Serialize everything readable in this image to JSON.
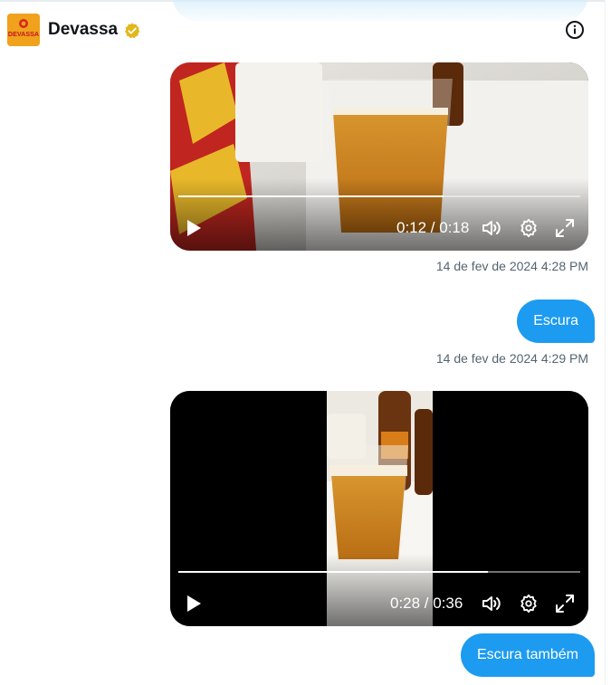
{
  "header": {
    "name": "Devassa",
    "logo_text": "DEVASSA",
    "verified_icon": "verified-gold-badge-icon",
    "info_icon": "info-circle-icon"
  },
  "messages": [
    {
      "type": "video",
      "current_time": "0:12",
      "duration": "0:18",
      "time_text": "0:12 / 0:18",
      "progress": 0.66,
      "timestamp": "14 de fev de 2024 4:28 PM"
    },
    {
      "type": "text",
      "text": "Escura",
      "timestamp": "14 de fev de 2024 4:29 PM"
    },
    {
      "type": "video",
      "current_time": "0:28",
      "duration": "0:36",
      "time_text": "0:28 / 0:36",
      "progress": 0.77
    },
    {
      "type": "text",
      "text": "Escura também"
    }
  ],
  "colors": {
    "accent": "#1d9bf0",
    "verified_gold": "#e2b719",
    "timestamp": "#536471"
  }
}
